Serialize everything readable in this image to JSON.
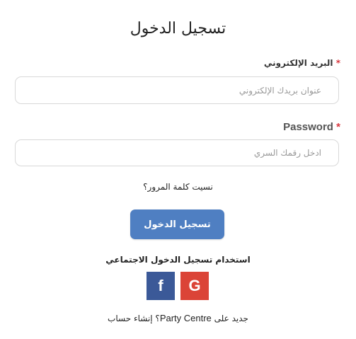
{
  "page": {
    "title": "تسجيل الدخول"
  },
  "email": {
    "label": "البريد الإلكتروني",
    "required_mark": "*",
    "placeholder": "عنوان بريدك الإلكتروني"
  },
  "password": {
    "label": "Password",
    "required_mark": "*",
    "placeholder": "ادخل رقمك السري"
  },
  "forgot_password": "نسيت كلمة المرور؟",
  "login_button": "تسجيل الدخول",
  "social": {
    "heading": "استخدام تسجيل الدخول الاجتماعي",
    "facebook_glyph": "f",
    "google_glyph": "G",
    "facebook_color": "#3b5998",
    "google_color": "#db4437"
  },
  "signup": {
    "prefix": "جديد على",
    "brand": "Party Centre",
    "suffix": "؟ إنشاء حساب"
  },
  "colors": {
    "accent": "#4f7fc2",
    "required": "#d9363e"
  }
}
